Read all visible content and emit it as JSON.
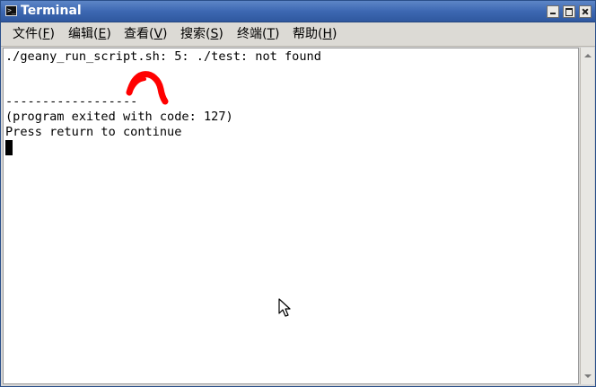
{
  "window": {
    "title": "Terminal"
  },
  "menu": {
    "items": [
      {
        "label": "文件(",
        "mnemonic": "F",
        "close": ")"
      },
      {
        "label": "编辑(",
        "mnemonic": "E",
        "close": ")"
      },
      {
        "label": "查看(",
        "mnemonic": "V",
        "close": ")"
      },
      {
        "label": "搜索(",
        "mnemonic": "S",
        "close": ")"
      },
      {
        "label": "终端(",
        "mnemonic": "T",
        "close": ")"
      },
      {
        "label": "帮助(",
        "mnemonic": "H",
        "close": ")"
      }
    ]
  },
  "terminal": {
    "lines": [
      "./geany_run_script.sh: 5: ./test: not found",
      "",
      "",
      "------------------",
      "(program exited with code: 127)",
      "Press return to continue"
    ]
  },
  "colors": {
    "titlebar": "#3d68b2",
    "annotation": "#ff0000",
    "terminal_bg": "#ffffff",
    "terminal_fg": "#000000"
  },
  "icons": {
    "app_icon": "terminal-icon",
    "minimize": "minimize-icon",
    "maximize": "maximize-icon",
    "close": "close-icon",
    "pointer": "mouse-pointer-icon"
  }
}
